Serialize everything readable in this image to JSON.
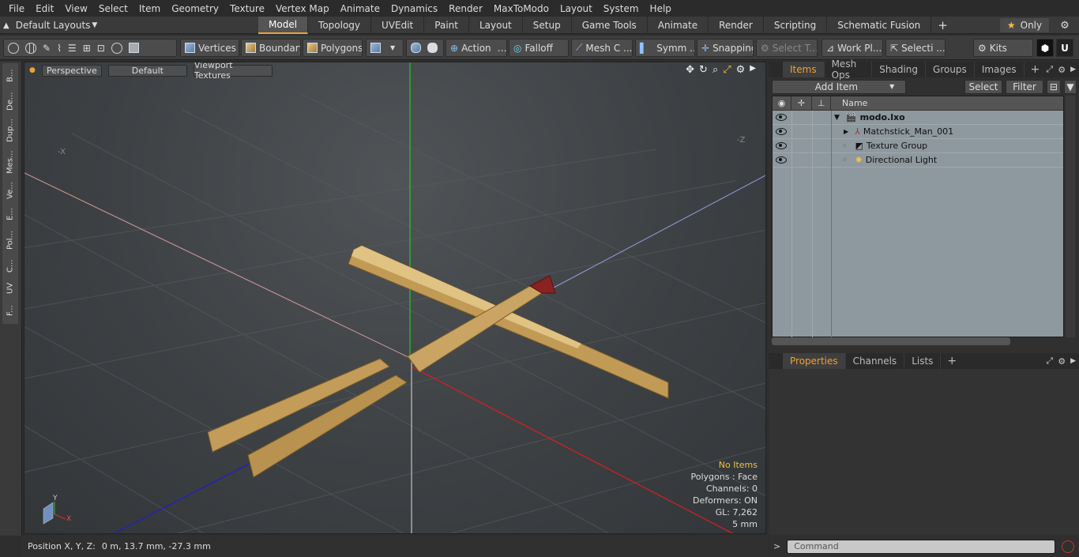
{
  "menu": [
    "File",
    "Edit",
    "View",
    "Select",
    "Item",
    "Geometry",
    "Texture",
    "Vertex Map",
    "Animate",
    "Dynamics",
    "Render",
    "MaxToModo",
    "Layout",
    "System",
    "Help"
  ],
  "layouts": {
    "label": "Default Layouts"
  },
  "tabs": {
    "items": [
      "Model",
      "Topology",
      "UVEdit",
      "Paint",
      "Layout",
      "Setup",
      "Game Tools",
      "Animate",
      "Render",
      "Scripting",
      "Schematic Fusion"
    ],
    "active": "Model",
    "only_label": "Only"
  },
  "toolbar": {
    "vertices": "Vertices",
    "boundary": "Boundary",
    "polygons": "Polygons",
    "action": "Action",
    "falloff": "Falloff",
    "mesh": "Mesh C ...",
    "symm": "Symm ...",
    "snapping": "Snapping",
    "select_t": "Select T...",
    "workplane": "Work Pl...",
    "selecti": "Selecti ...",
    "kits": "Kits"
  },
  "left_tabs": [
    "B...",
    "De...",
    "Dup...",
    "Mes...",
    "Ve...",
    "E...",
    "Pol...",
    "C...",
    "UV",
    "F..."
  ],
  "viewport": {
    "perspective": "Perspective",
    "default": "Default",
    "textures": "Viewport Textures",
    "axis_x": "-X",
    "axis_z": "-Z",
    "info": {
      "no_items": "No Items",
      "polygons": "Polygons : Face",
      "channels": "Channels: 0",
      "deformers": "Deformers: ON",
      "gl": "GL: 7,262",
      "unit": "5 mm"
    },
    "gizmo_y": "Y",
    "gizmo_x": "X"
  },
  "status": {
    "label": "Position X, Y, Z:",
    "value": "0 m, 13.7 mm, -27.3 mm"
  },
  "items_panel": {
    "tabs": [
      "Items",
      "Mesh Ops",
      "Shading",
      "Groups",
      "Images"
    ],
    "add_item": "Add Item",
    "select": "Select",
    "filter": "Filter",
    "name_col": "Name",
    "rows": [
      "modo.lxo",
      "Matchstick_Man_001",
      "Texture Group",
      "Directional Light"
    ]
  },
  "props_panel": {
    "tabs": [
      "Properties",
      "Channels",
      "Lists"
    ]
  },
  "command": {
    "placeholder": "Command",
    "prompt": ">"
  }
}
